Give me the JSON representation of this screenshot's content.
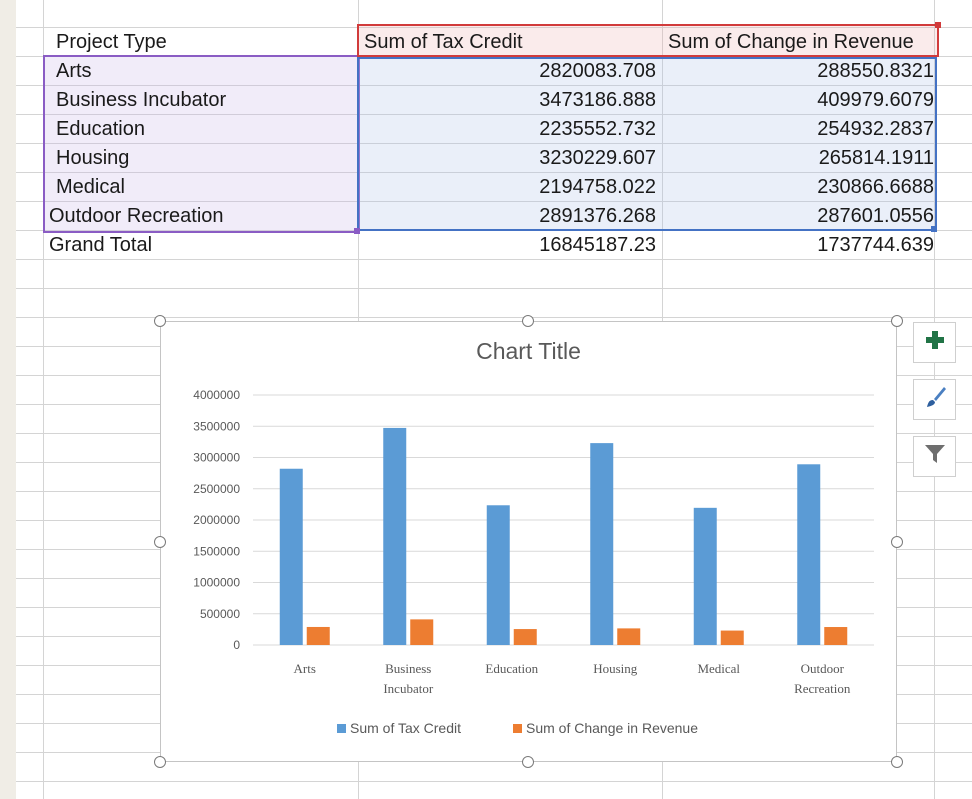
{
  "pivot": {
    "headers": {
      "project_type": "Project Type",
      "tax_credit": "Sum of Tax Credit",
      "change_revenue": "Sum of Change in Revenue"
    },
    "rows": [
      {
        "label": "Arts",
        "tax_credit": "2820083.708",
        "change_revenue": "288550.8321"
      },
      {
        "label": "Business Incubator",
        "tax_credit": "3473186.888",
        "change_revenue": "409979.6079"
      },
      {
        "label": "Education",
        "tax_credit": "2235552.732",
        "change_revenue": "254932.2837"
      },
      {
        "label": "Housing",
        "tax_credit": "3230229.607",
        "change_revenue": "265814.1911"
      },
      {
        "label": "Medical",
        "tax_credit": "2194758.022",
        "change_revenue": "230866.6688"
      },
      {
        "label": "Outdoor Recreation",
        "tax_credit": "2891376.268",
        "change_revenue": "287601.0556"
      }
    ],
    "grand_total": {
      "label": "Grand Total",
      "tax_credit": "16845187.23",
      "change_revenue": "1737744.639"
    }
  },
  "chart_data": {
    "type": "bar",
    "title": "Chart Title",
    "categories": [
      "Arts",
      "Business Incubator",
      "Education",
      "Housing",
      "Medical",
      "Outdoor Recreation"
    ],
    "series": [
      {
        "name": "Sum of Tax Credit",
        "color": "#5b9bd5",
        "values": [
          2820083.708,
          3473186.888,
          2235552.732,
          3230229.607,
          2194758.022,
          2891376.268
        ]
      },
      {
        "name": "Sum of Change in Revenue",
        "color": "#ed7d31",
        "values": [
          288550.8321,
          409979.6079,
          254932.2837,
          265814.1911,
          230866.6688,
          287601.0556
        ]
      }
    ],
    "ylim": [
      0,
      4000000
    ],
    "yticks": [
      0,
      500000,
      1000000,
      1500000,
      2000000,
      2500000,
      3000000,
      3500000,
      4000000
    ],
    "grid": true,
    "legend": "bottom"
  },
  "chart_tools": {
    "elements_icon": "plus-icon",
    "styles_icon": "brush-icon",
    "filters_icon": "filter-icon",
    "accent_color": "#217346"
  }
}
